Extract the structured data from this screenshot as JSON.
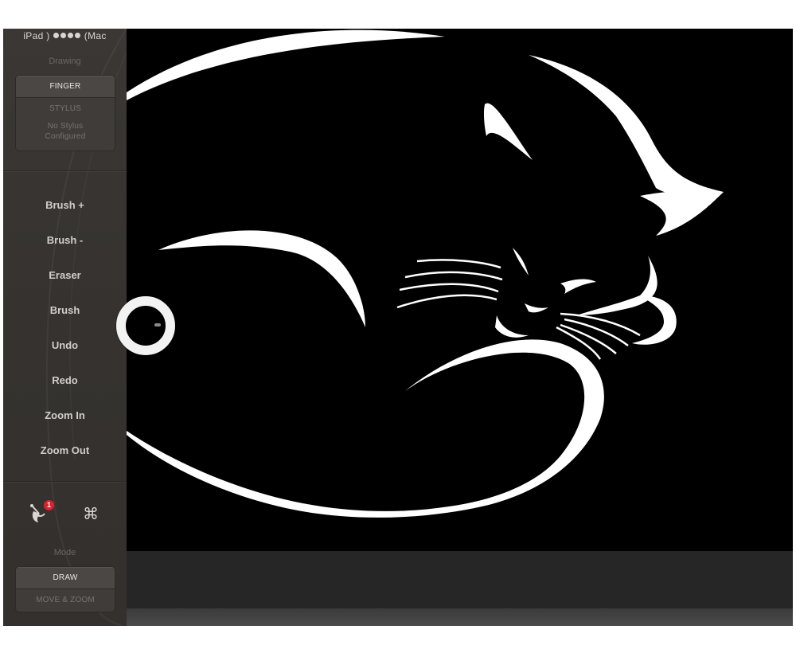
{
  "connection": {
    "device": "iPad",
    "target": "Mac",
    "signal_dots": 4
  },
  "drawing": {
    "label": "Drawing",
    "options": [
      "FINGER",
      "STYLUS",
      "No Stylus Configured"
    ],
    "selected": "FINGER"
  },
  "commands": [
    {
      "label": "Brush +"
    },
    {
      "label": "Brush -"
    },
    {
      "label": "Eraser"
    },
    {
      "label": "Brush"
    },
    {
      "label": "Undo"
    },
    {
      "label": "Redo"
    },
    {
      "label": "Zoom In"
    },
    {
      "label": "Zoom Out"
    }
  ],
  "tools": {
    "app_icon": "paint-brush-icon",
    "notification_count": "1",
    "shortcut_glyph": "⌘"
  },
  "mode": {
    "label": "Mode",
    "options": [
      "DRAW",
      "MOVE & ZOOM"
    ],
    "selected": "DRAW"
  },
  "colors": {
    "sidebar": "#36332f",
    "canvas_background": "#000000",
    "artwork": "#ffffff",
    "badge": "#e0202a"
  }
}
